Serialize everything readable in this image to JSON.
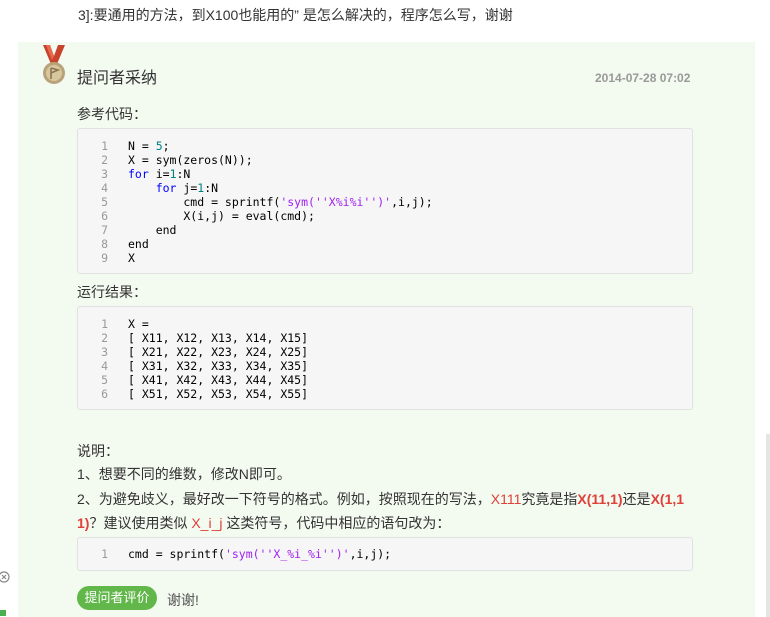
{
  "question_tail": "3]:要通用的方法，到X100也能用的” 是怎么解决的，程序怎么写，谢谢",
  "answer": {
    "title": "提问者采纳",
    "date": "2014-07-28 07:02",
    "ref_label": "参考代码：",
    "code1": [
      {
        "n": "1",
        "t": "N = 5;"
      },
      {
        "n": "2",
        "t": "X = sym(zeros(N));"
      },
      {
        "n": "3",
        "t": "for i=1:N"
      },
      {
        "n": "4",
        "t": "    for j=1:N"
      },
      {
        "n": "5",
        "t": "        cmd = sprintf('sym(''X%i%i'')',i,j);"
      },
      {
        "n": "6",
        "t": "        X(i,j) = eval(cmd);"
      },
      {
        "n": "7",
        "t": "    end"
      },
      {
        "n": "8",
        "t": "end"
      },
      {
        "n": "9",
        "t": "X"
      }
    ],
    "result_label": "运行结果：",
    "code2": [
      {
        "n": "1",
        "t": "X ="
      },
      {
        "n": "2",
        "t": "[ X11, X12, X13, X14, X15]"
      },
      {
        "n": "3",
        "t": "[ X21, X22, X23, X24, X25]"
      },
      {
        "n": "4",
        "t": "[ X31, X32, X33, X34, X35]"
      },
      {
        "n": "5",
        "t": "[ X41, X42, X43, X44, X45]"
      },
      {
        "n": "6",
        "t": "[ X51, X52, X53, X54, X55]"
      }
    ],
    "desc_title": "说明：",
    "desc1": "1、想要不同的维数，修改N即可。",
    "desc2_a": "2、为避免歧义，最好改一下符号的格式。例如，按照现在的写法，",
    "desc2_b": "X111",
    "desc2_c": "究竟是指",
    "desc2_d": "X(11,1)",
    "desc2_e": "还是",
    "desc2_f": "X(1,1",
    "desc3_a": "1)",
    "desc3_b": "？建议使用类似 ",
    "desc3_c": "X_i_j",
    "desc3_d": " 这类符号，代码中相应的语句改为：",
    "code3": [
      {
        "n": "1",
        "t": "cmd = sprintf('sym(''X_%i_%i'')',i,j);"
      }
    ],
    "eval_button": "提问者评价",
    "thanks": "谢谢!"
  }
}
